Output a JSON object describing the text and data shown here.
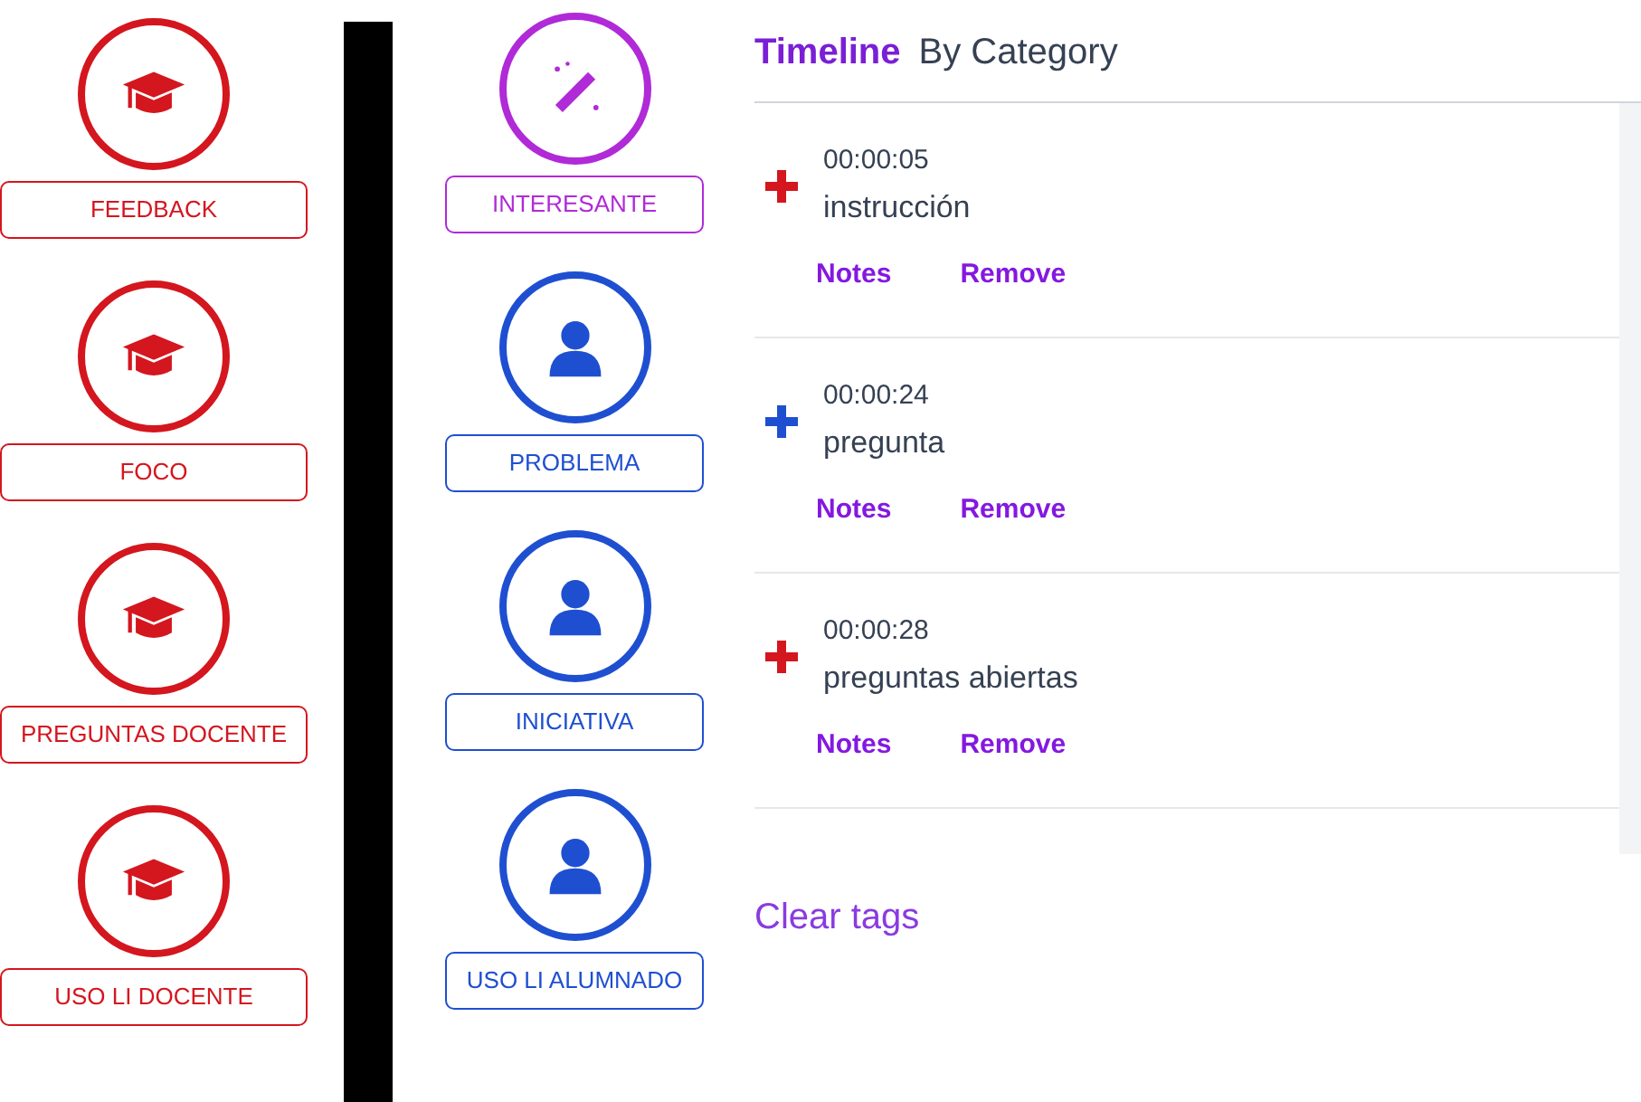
{
  "tag_columns": [
    [
      {
        "label": "FEEDBACK",
        "kind": "cap",
        "color": "#d4161e"
      },
      {
        "label": "FOCO",
        "kind": "cap",
        "color": "#d4161e"
      },
      {
        "label": "PREGUNTAS DOCENTE",
        "kind": "cap",
        "color": "#d4161e"
      },
      {
        "label": "USO LI DOCENTE",
        "kind": "cap",
        "color": "#d4161e"
      }
    ],
    [
      {
        "label": "INTERESANTE",
        "kind": "wand",
        "color": "#b02ad8"
      },
      {
        "label": "PROBLEMA",
        "kind": "person",
        "color": "#1f4fd1"
      },
      {
        "label": "INICIATIVA",
        "kind": "person",
        "color": "#1f4fd1"
      },
      {
        "label": "USO LI ALUMNADO",
        "kind": "person",
        "color": "#1f4fd1"
      }
    ]
  ],
  "tabs": [
    {
      "label": "Timeline",
      "selected": true
    },
    {
      "label": "By Category",
      "selected": false
    }
  ],
  "timeline": [
    {
      "time": "00:00:05",
      "tag": "instrucción",
      "color": "#d4161e",
      "actions": [
        "Notes",
        "Remove"
      ]
    },
    {
      "time": "00:00:24",
      "tag": "pregunta",
      "color": "#1f4fd1",
      "actions": [
        "Notes",
        "Remove"
      ]
    },
    {
      "time": "00:00:28",
      "tag": "preguntas abiertas",
      "color": "#d4161e",
      "actions": [
        "Notes",
        "Remove"
      ]
    }
  ],
  "clear_link": "Clear tags"
}
